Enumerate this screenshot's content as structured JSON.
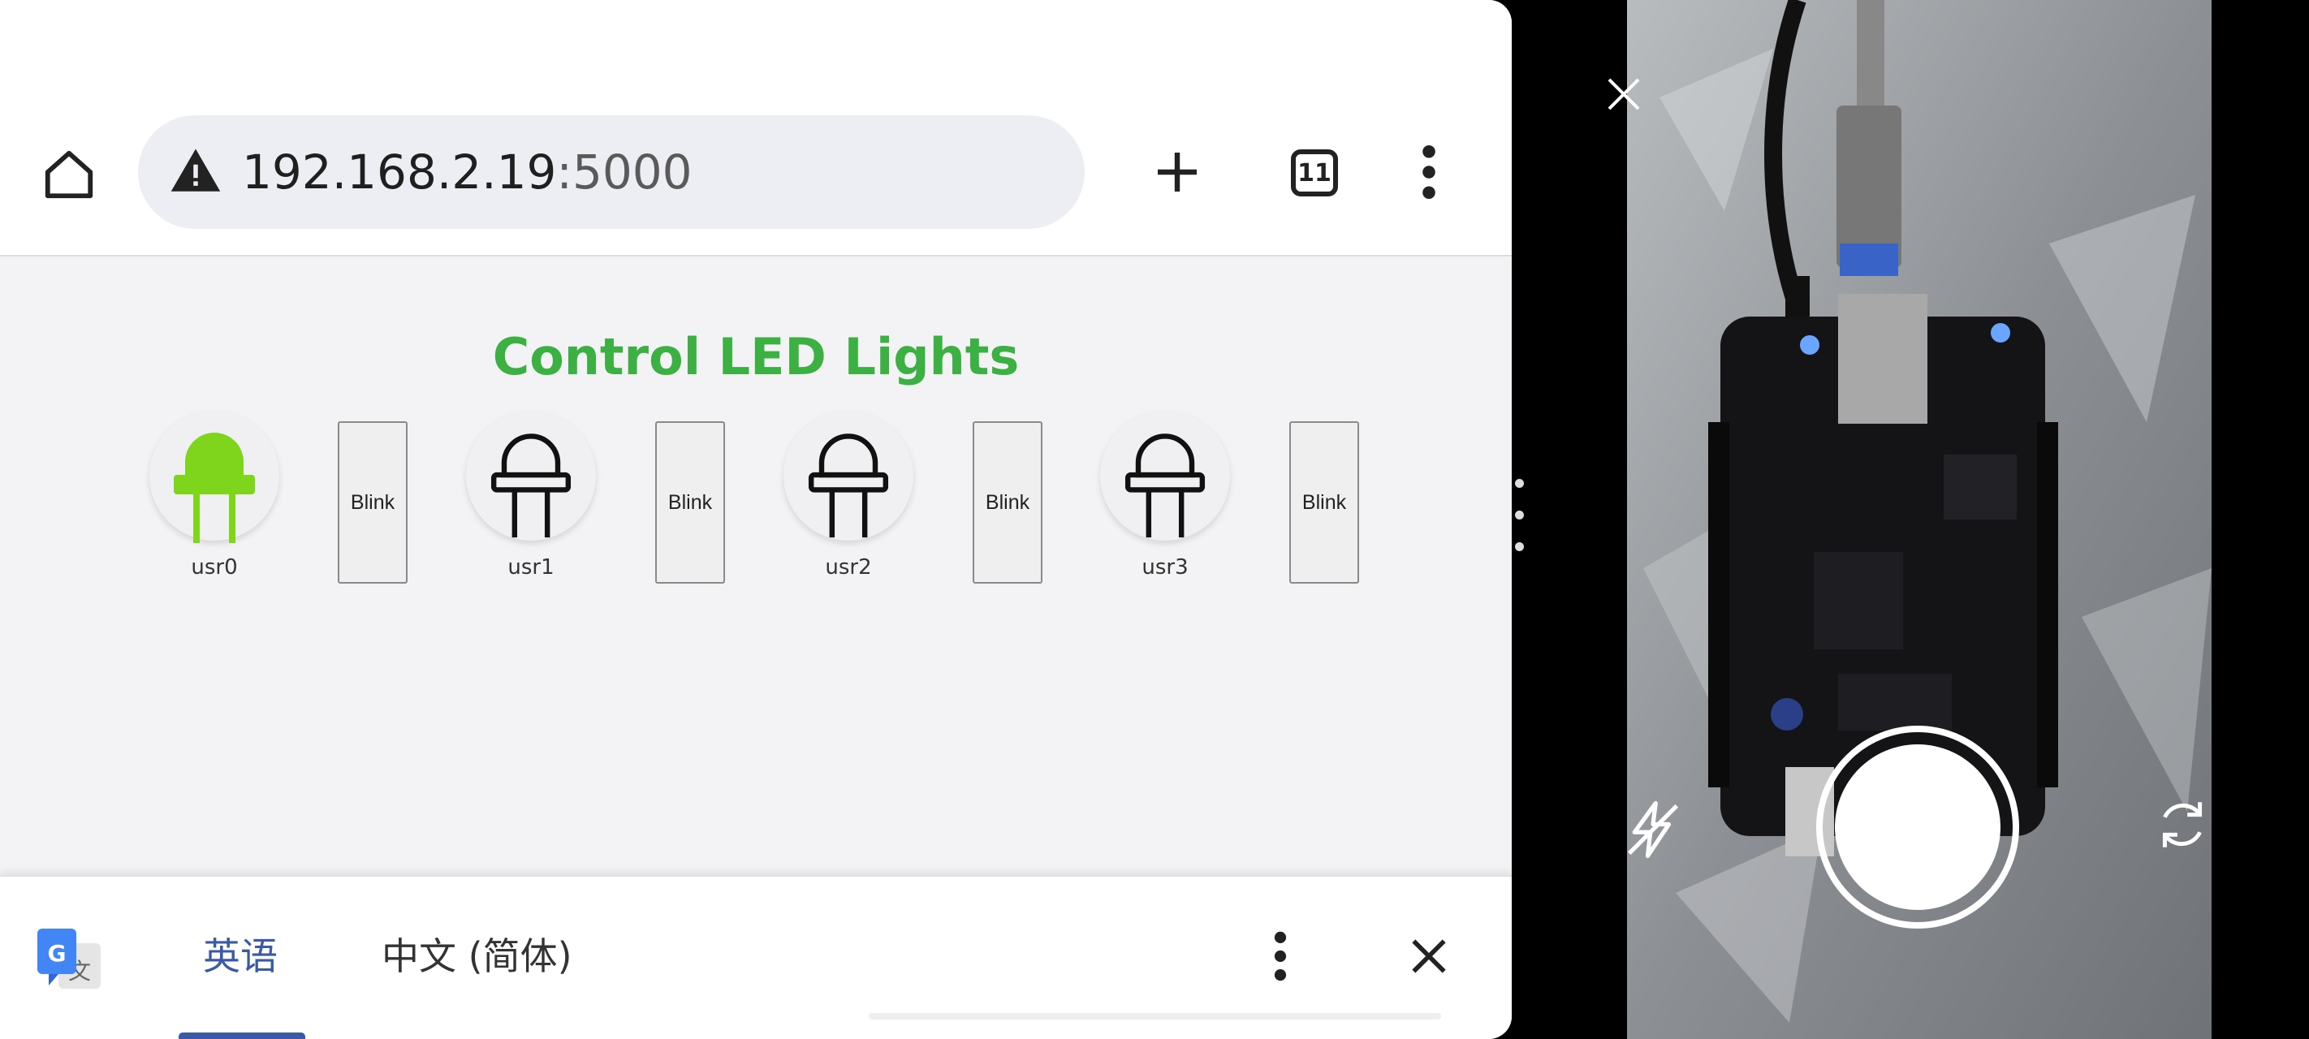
{
  "browser": {
    "url_host": "192.168.2.19",
    "url_port": ":5000",
    "tab_count": "11",
    "icons": [
      "home-icon",
      "warning-icon",
      "plus-icon",
      "tabs-icon",
      "more-vert-icon"
    ]
  },
  "page": {
    "title": "Control LED Lights",
    "leds": [
      {
        "label": "usr0",
        "on": true
      },
      {
        "label": "usr1",
        "on": false
      },
      {
        "label": "usr2",
        "on": false
      },
      {
        "label": "usr3",
        "on": false
      }
    ],
    "blink_label": "Blink",
    "colors": {
      "title": "#3cb043",
      "led_on": "#7fd41c"
    }
  },
  "translate_bar": {
    "source_lang": "英语",
    "target_lang": "中文 (简体)",
    "icons": [
      "google-translate-icon",
      "more-vert-icon",
      "close-icon"
    ]
  },
  "camera": {
    "icons": [
      "close-icon",
      "flash-off-icon",
      "shutter-button",
      "flip-camera-icon"
    ]
  }
}
